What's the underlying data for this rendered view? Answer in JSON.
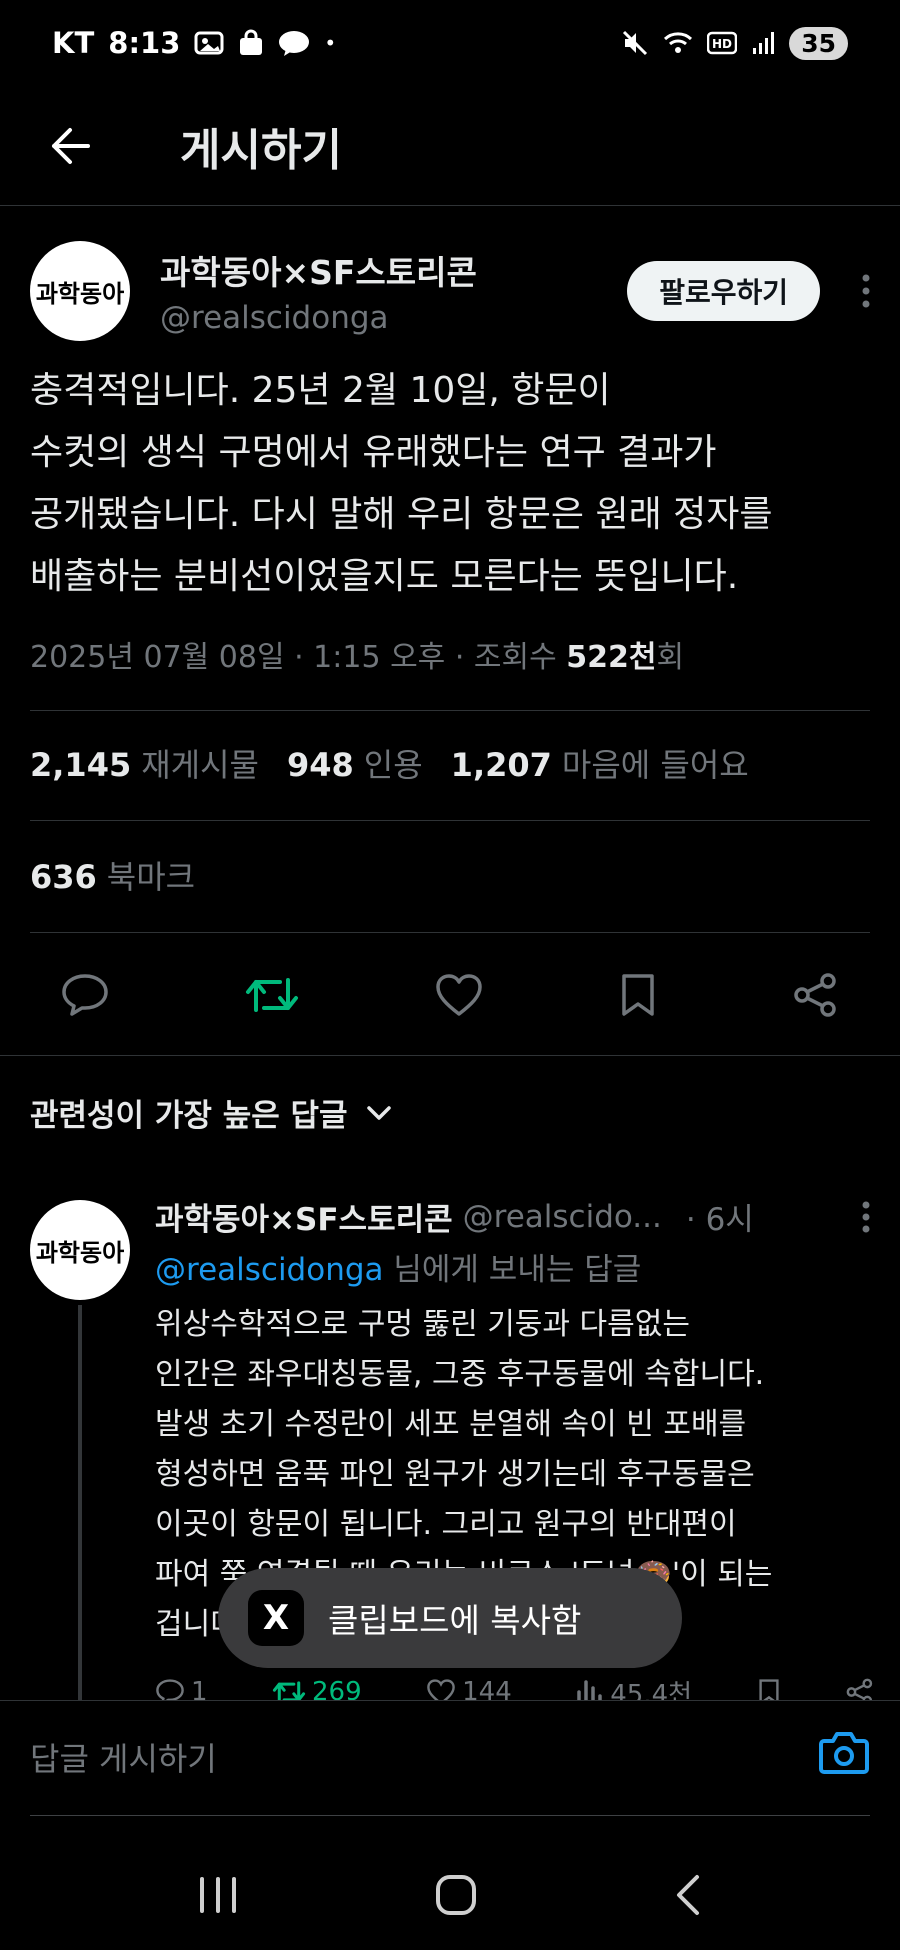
{
  "status_bar": {
    "carrier": "KT",
    "time": "8:13",
    "notification_dot": "•",
    "battery": "35",
    "icons": [
      "gallery-icon",
      "shopping-bag-icon",
      "kakaotalk-icon",
      "mute-icon",
      "wifi-icon",
      "hd-icon",
      "signal-icon"
    ]
  },
  "header": {
    "title": "게시하기"
  },
  "post": {
    "avatar_text": "과학동아",
    "display_name": "과학동아×SF스토리콘",
    "handle": "@realscidonga",
    "follow_label": "팔로우하기",
    "text": "충격적입니다. 25년 2월 10일, 항문이\n수컷의 생식 구멍에서 유래했다는 연구 결과가\n공개됐습니다. 다시 말해 우리 항문은 원래 정자를\n배출하는 분비선이었을지도 모른다는 뜻입니다.",
    "date": "2025년 07월 08일 · 1:15 오후 · 조회수 ",
    "views": "522천",
    "views_suffix": "회"
  },
  "stats": {
    "reposts_count": "2,145",
    "reposts_label": "재게시물",
    "quotes_count": "948",
    "quotes_label": "인용",
    "likes_count": "1,207",
    "likes_label": "마음에 들어요",
    "bookmarks_count": "636",
    "bookmarks_label": "북마크"
  },
  "sort": {
    "label": "관련성이 가장 높은 답글"
  },
  "reply": {
    "avatar_text": "과학동아",
    "display_name": "과학동아×SF스토리콘",
    "handle": "@realscido...",
    "time": "· 6시",
    "replying_mention": "@realscidonga",
    "replying_suffix": " 님에게 보내는 답글",
    "text": "위상수학적으로 구멍 뚫린 기둥과 다름없는\n인간은 좌우대칭동물, 그중 후구동물에 속합니다.\n발생 초기 수정란이 세포 분열해 속이 빈 포배를\n형성하면 움푹 파인 원구가 생기는데 후구동물은\n이곳이 항문이 됩니다. 그리고 원구의 반대편이\n파여 쭉 연결될 때 우리는 비로소 '도넛🍩'이 되는\n겁니다.",
    "replies": "1",
    "reposts": "269",
    "likes": "144",
    "views": "45.4천"
  },
  "toast": {
    "icon_letter": "X",
    "text": "클립보드에 복사함"
  },
  "compose": {
    "placeholder": "답글 게시하기"
  },
  "colors": {
    "background": "#000000",
    "text": "#e7e9ea",
    "muted": "#71767b",
    "accent": "#1d9bf0",
    "repost_green": "#00ba7c"
  }
}
